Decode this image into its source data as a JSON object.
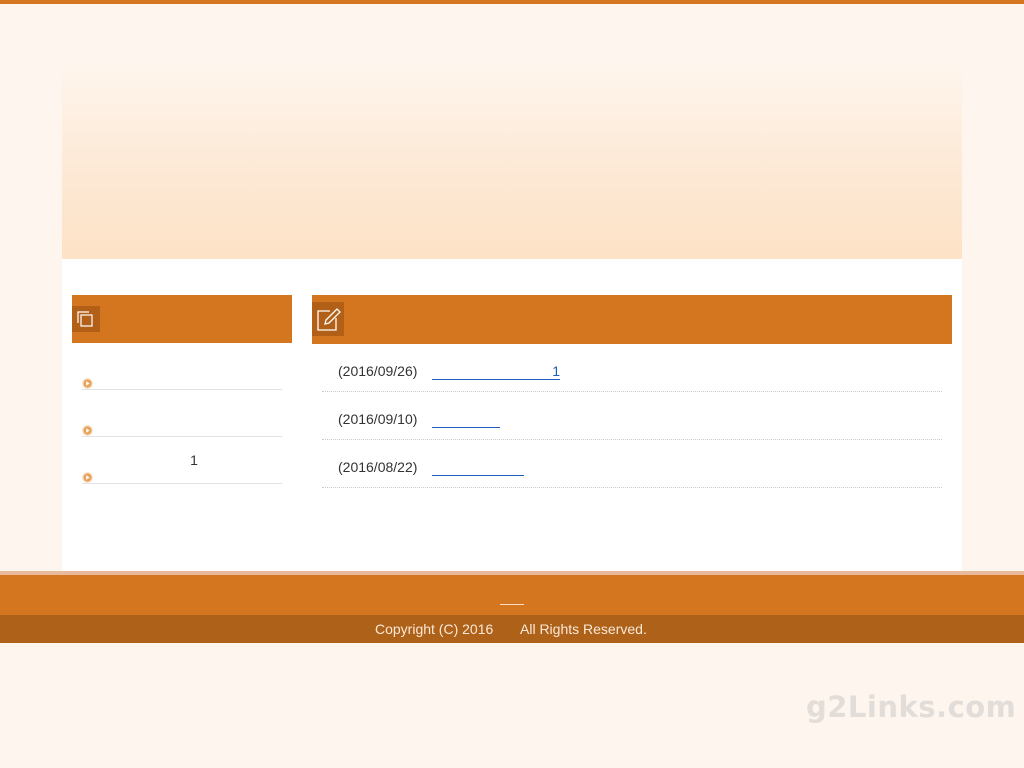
{
  "sidebar": {
    "items": [
      {
        "label": ""
      },
      {
        "label": ""
      },
      {
        "label": "1"
      }
    ]
  },
  "news": {
    "items": [
      {
        "date": "(2016/09/26)",
        "link": "1"
      },
      {
        "date": "(2016/09/10)",
        "link": ""
      },
      {
        "date": "(2016/08/22)",
        "link": ""
      }
    ]
  },
  "footer": {
    "copyright_left": "Copyright (C) 2016",
    "copyright_right": "All Rights Reserved."
  },
  "watermark": "g2Links.com",
  "colors": {
    "accent": "#d3761f",
    "accent_dark": "#ad6119",
    "link": "#1f5fbf",
    "background": "#fdf5ee"
  }
}
